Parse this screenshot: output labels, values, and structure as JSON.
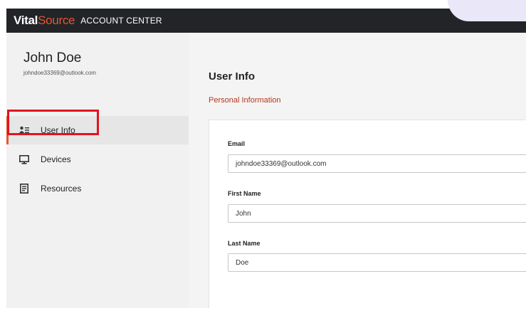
{
  "header": {
    "brand_vital": "Vital",
    "brand_source": "Source",
    "brand_suffix": "ACCOUNT CENTER"
  },
  "sidebar": {
    "user_name": "John Doe",
    "user_email": "johndoe33369@outlook.com",
    "items": [
      {
        "label": "User Info",
        "icon": "user-list-icon",
        "active": true
      },
      {
        "label": "Devices",
        "icon": "monitor-icon",
        "active": false
      },
      {
        "label": "Resources",
        "icon": "book-icon",
        "active": false
      }
    ]
  },
  "main": {
    "title": "User Info",
    "subtitle": "Personal Information",
    "fields": [
      {
        "label": "Email",
        "value": "johndoe33369@outlook.com"
      },
      {
        "label": "First Name",
        "value": "John"
      },
      {
        "label": "Last Name",
        "value": "Doe"
      }
    ]
  },
  "colors": {
    "accent": "#e4572e",
    "topbar": "#222428",
    "highlight": "#e1141e",
    "subtitle": "#b0381e"
  }
}
